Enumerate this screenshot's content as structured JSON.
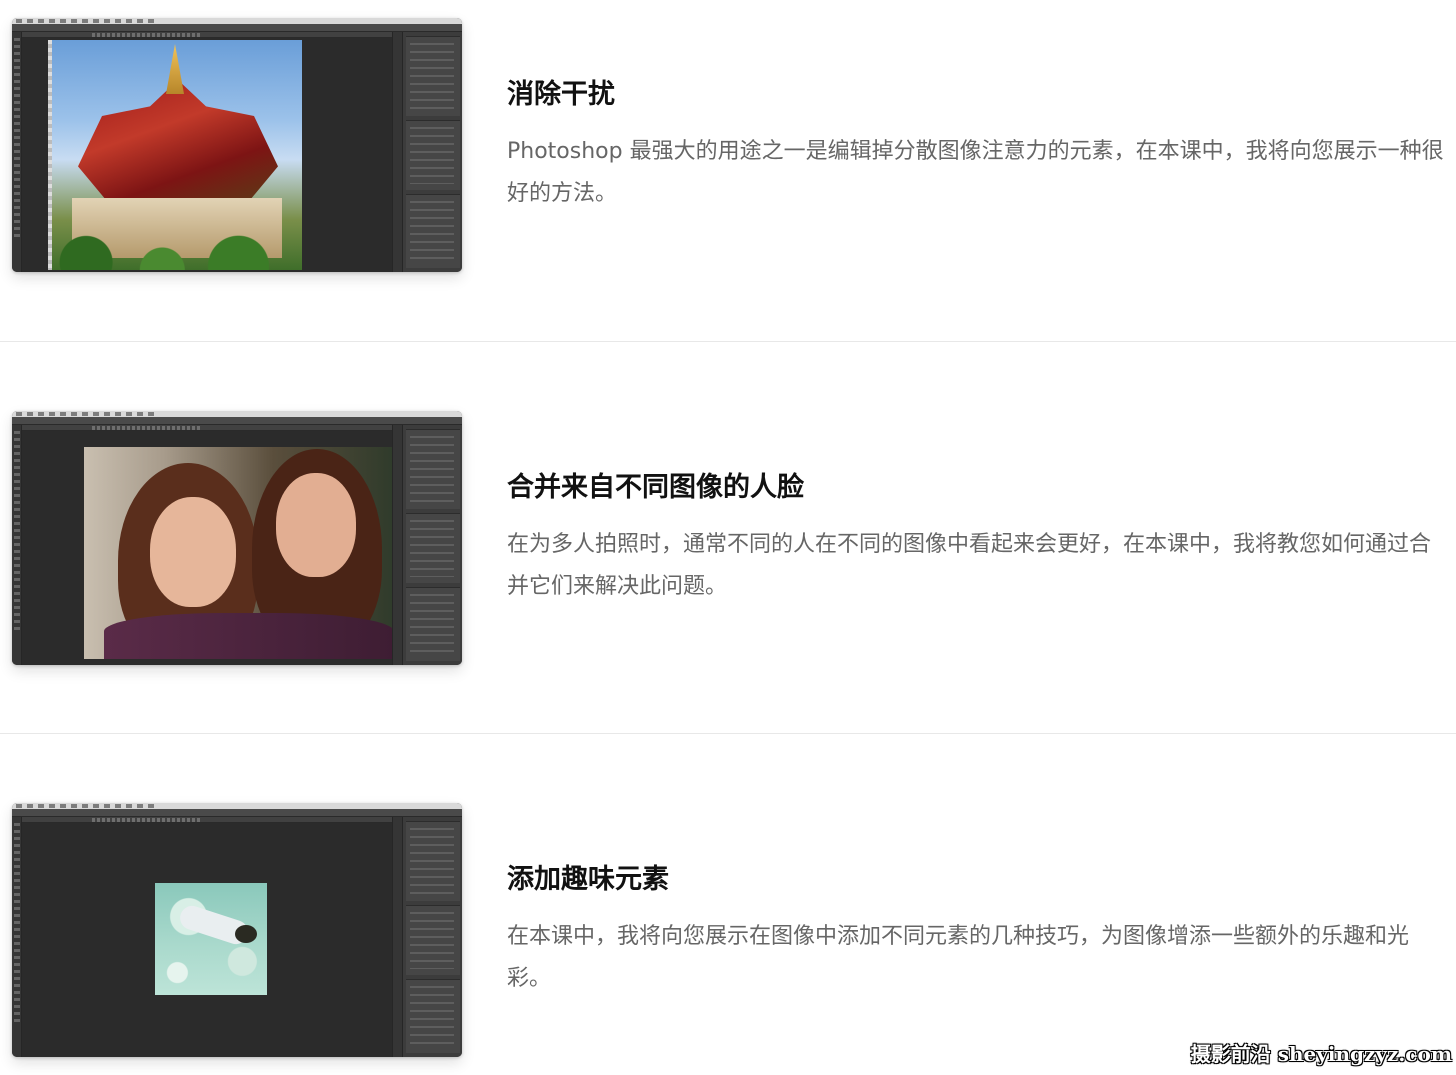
{
  "lessons": [
    {
      "title": "消除干扰",
      "description": "Photoshop 最强大的用途之一是编辑掉分散图像注意力的元素，在本课中，我将向您展示一种很好的方法。"
    },
    {
      "title": "合并来自不同图像的人脸",
      "description": "在为多人拍照时，通常不同的人在不同的图像中看起来会更好，在本课中，我将教您如何通过合并它们来解决此问题。"
    },
    {
      "title": "添加趣味元素",
      "description": "在本课中，我将向您展示在图像中添加不同元素的几种技巧，为图像增添一些额外的乐趣和光彩。"
    }
  ],
  "watermark": "摄影前沿 sheyingzyz.com"
}
